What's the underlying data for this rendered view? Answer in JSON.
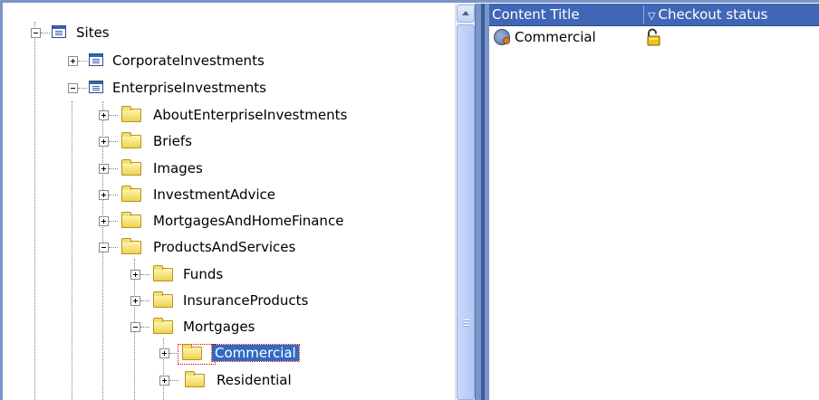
{
  "tree": {
    "nodes": [
      {
        "label": "Sites",
        "type": "site",
        "expander": "minus"
      },
      {
        "label": "CorporateInvestments",
        "type": "site",
        "expander": "plus"
      },
      {
        "label": "EnterpriseInvestments",
        "type": "site",
        "expander": "minus"
      },
      {
        "label": "AboutEnterpriseInvestments",
        "type": "folder",
        "expander": "plus"
      },
      {
        "label": "Briefs",
        "type": "folder",
        "expander": "plus"
      },
      {
        "label": "Images",
        "type": "folder",
        "expander": "plus"
      },
      {
        "label": "InvestmentAdvice",
        "type": "folder",
        "expander": "plus"
      },
      {
        "label": "MortgagesAndHomeFinance",
        "type": "folder",
        "expander": "plus"
      },
      {
        "label": "ProductsAndServices",
        "type": "folder",
        "expander": "minus"
      },
      {
        "label": "Funds",
        "type": "folder",
        "expander": "plus"
      },
      {
        "label": "InsuranceProducts",
        "type": "folder",
        "expander": "plus"
      },
      {
        "label": "Mortgages",
        "type": "folder",
        "expander": "minus"
      },
      {
        "label": "Commercial",
        "type": "folder",
        "expander": "plus",
        "selected": true
      },
      {
        "label": "Residential",
        "type": "folder",
        "expander": "plus"
      }
    ]
  },
  "list": {
    "columns": [
      {
        "label": "Content Title"
      },
      {
        "label": "Checkout status",
        "sort_icon": "▽"
      }
    ],
    "rows": [
      {
        "title": "Commercial",
        "icon": "content-item-icon",
        "status_icon": "unlocked-padlock-icon"
      }
    ]
  },
  "colors": {
    "header_bg": "#4067b6",
    "selection_bg": "#316ac5",
    "splitter": "#7a95c8"
  }
}
